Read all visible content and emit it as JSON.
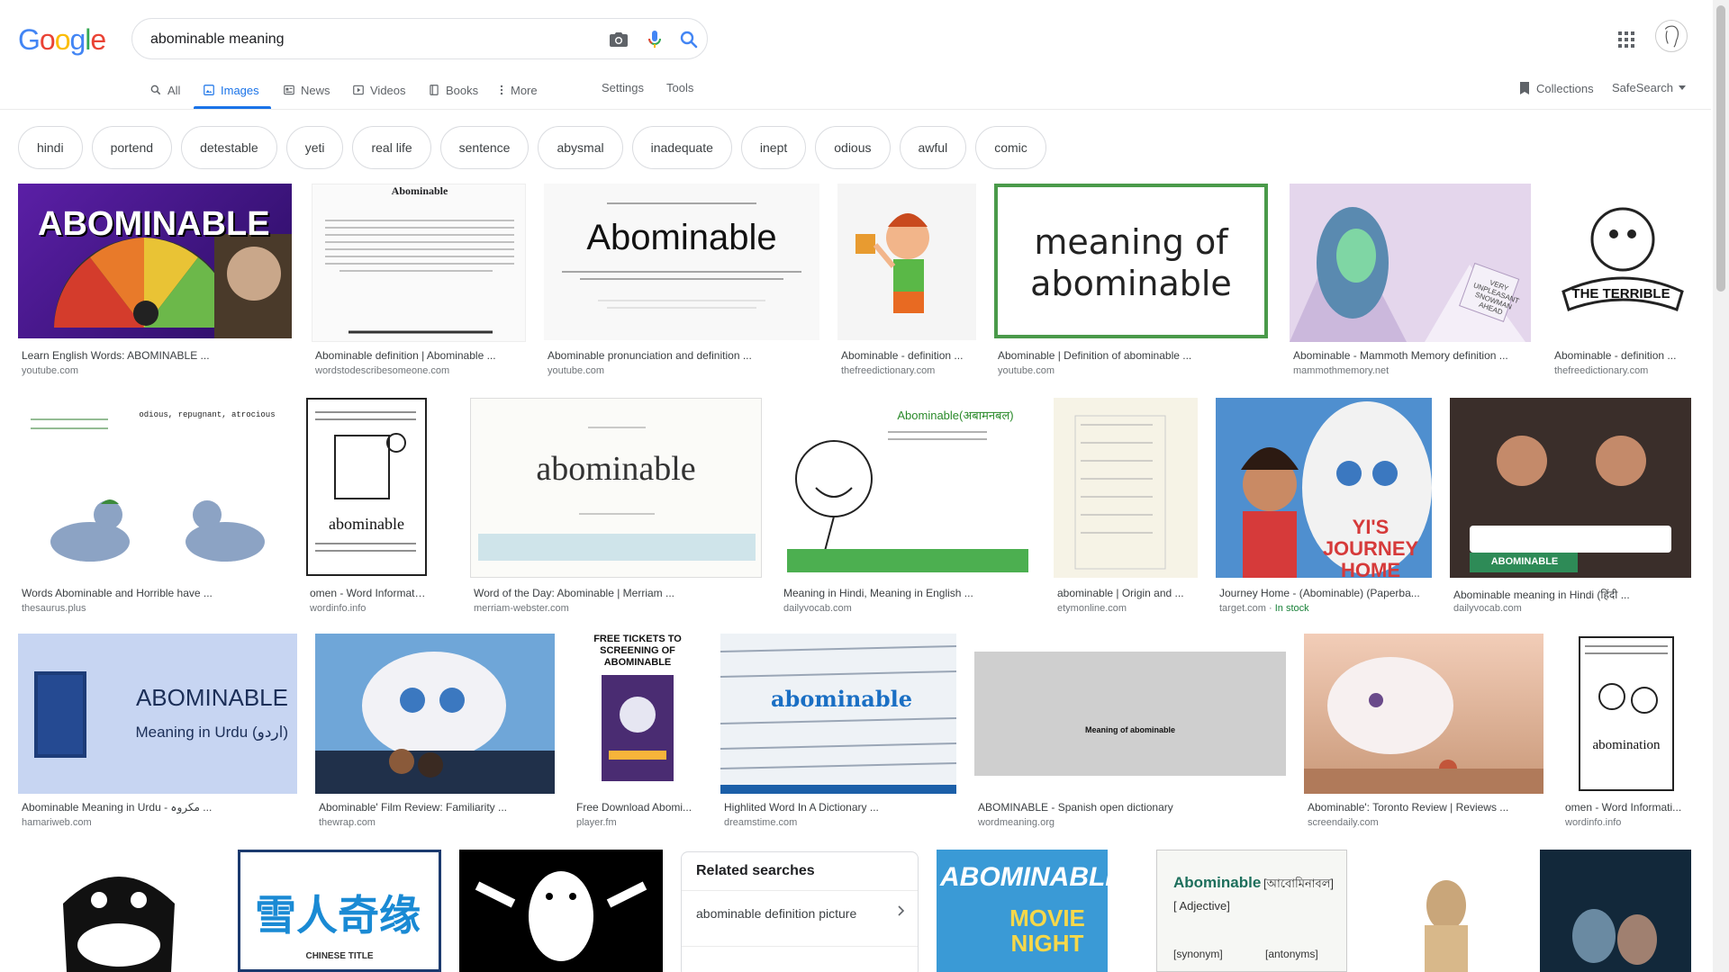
{
  "logo": {
    "letters": [
      "G",
      "o",
      "o",
      "g",
      "l",
      "e"
    ],
    "colors": [
      "#4285f4",
      "#ea4335",
      "#fbbc05",
      "#4285f4",
      "#34a853",
      "#ea4335"
    ]
  },
  "search": {
    "query": "abominable meaning"
  },
  "tabs": [
    {
      "label": "All",
      "icon": "search-icon",
      "active": false
    },
    {
      "label": "Images",
      "icon": "image-icon",
      "active": true
    },
    {
      "label": "News",
      "icon": "news-icon",
      "active": false
    },
    {
      "label": "Videos",
      "icon": "video-icon",
      "active": false
    },
    {
      "label": "Books",
      "icon": "book-icon",
      "active": false
    },
    {
      "label": "More",
      "icon": "more-vert-icon",
      "active": false
    }
  ],
  "tools": {
    "settings": "Settings",
    "tools": "Tools"
  },
  "right_tools": {
    "collections": "Collections",
    "safesearch": "SafeSearch"
  },
  "chips": [
    "hindi",
    "portend",
    "detestable",
    "yeti",
    "real life",
    "sentence",
    "abysmal",
    "inadequate",
    "inept",
    "odious",
    "awful",
    "comic"
  ],
  "results_row1": [
    {
      "title": "Learn English Words: ABOMINABLE ...",
      "source": "youtube.com",
      "thumb_text": "ABOMINABLE"
    },
    {
      "title": "Abominable definition | Abominable ...",
      "source": "wordstodescribesomeone.com",
      "thumb_text": "Abominable"
    },
    {
      "title": "Abominable pronunciation and definition ...",
      "source": "youtube.com",
      "thumb_text": "Abominable"
    },
    {
      "title": "Abominable - definition ...",
      "source": "thefreedictionary.com",
      "thumb_text": ""
    },
    {
      "title": "Abominable | Definition of abominable ...",
      "source": "youtube.com",
      "thumb_text": "meaning of abominable"
    },
    {
      "title": "Abominable - Mammoth Memory definition ...",
      "source": "mammothmemory.net",
      "thumb_text": "VERY UNPLEASANT SNOWMAN AHEAD"
    },
    {
      "title": "Abominable - definition ...",
      "source": "thefreedictionary.com",
      "thumb_text": "THE TERRIBLE"
    }
  ],
  "results_row2": [
    {
      "title": "Words Abominable and Horrible have ...",
      "source": "thesaurus.plus",
      "thumb_text": "odious, repugnant, atrocious"
    },
    {
      "title": "omen - Word Information",
      "source": "wordinfo.info",
      "thumb_text": "abominable"
    },
    {
      "title": "Word of the Day: Abominable | Merriam ...",
      "source": "merriam-webster.com",
      "thumb_text": "abominable"
    },
    {
      "title": "Meaning in Hindi, Meaning in English ...",
      "source": "dailyvocab.com",
      "thumb_text": "Abominable(अबामनबल)"
    },
    {
      "title": "abominable | Origin and ...",
      "source": "etymonline.com",
      "thumb_text": ""
    },
    {
      "title": "Journey Home - (Abominable) (Paperba...",
      "source": "target.com",
      "stock": "In stock",
      "thumb_text": "YI'S JOURNEY HOME"
    },
    {
      "title": "Abominable meaning in Hindi (हिंदी ...",
      "source": "dailyvocab.com",
      "thumb_text": "ABOMINABLE"
    }
  ],
  "results_row3": [
    {
      "title": "Abominable Meaning in Urdu - مکروہ ...",
      "source": "hamariweb.com",
      "thumb_text": "ABOMINABLE",
      "thumb_sub": "Meaning in Urdu (اردو)"
    },
    {
      "title": "Abominable' Film Review: Familiarity ...",
      "source": "thewrap.com",
      "thumb_text": ""
    },
    {
      "title": "Free Download Abomi...",
      "source": "player.fm",
      "thumb_text": "FREE TICKETS TO SCREENING OF ABOMINABLE"
    },
    {
      "title": "Highlited Word In A Dictionary ...",
      "source": "dreamstime.com",
      "thumb_text": "abominable"
    },
    {
      "title": "ABOMINABLE - Spanish open dictionary",
      "source": "wordmeaning.org",
      "thumb_text": "Meaning of abominable"
    },
    {
      "title": "Abominable': Toronto Review | Reviews ...",
      "source": "screendaily.com",
      "thumb_text": ""
    },
    {
      "title": "omen - Word Informati...",
      "source": "wordinfo.info",
      "thumb_text": "abomination"
    }
  ],
  "related": {
    "title": "Related searches",
    "items": [
      "abominable definition picture"
    ]
  },
  "row4_texts": {
    "pearl_title": "雪人奇缘",
    "pearl_sub": "CHINESE TITLE",
    "movie_night": "MOVIE NIGHT",
    "abominable_logo": "ABOMINABLE",
    "dict_word": "Abominable",
    "dict_pron": "[আবোমিনাবল]",
    "dict_adj": "[ Adjective]",
    "dict_syn": "[synonym]",
    "dict_ant": "[antonyms]"
  }
}
